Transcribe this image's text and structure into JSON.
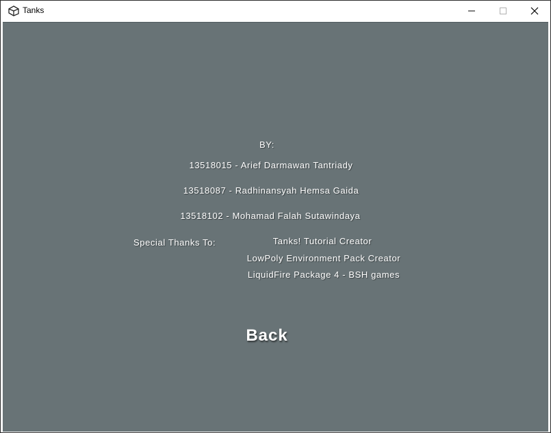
{
  "window": {
    "title": "Tanks"
  },
  "credits": {
    "by_label": "BY:",
    "authors": [
      "13518015 - Arief Darmawan Tantriady",
      "13518087 - Radhinansyah Hemsa Gaida",
      "13518102 - Mohamad Falah Sutawindaya"
    ],
    "thanks_label": "Special Thanks To:",
    "thanks": [
      "Tanks! Tutorial Creator",
      "LowPoly Environment Pack Creator",
      "LiquidFire Package 4 - BSH games"
    ]
  },
  "back_button": {
    "label": "Back"
  },
  "colors": {
    "background": "#687376",
    "text": "#ffffff"
  },
  "icons": {
    "app": "unity-icon",
    "minimize": "minimize-icon",
    "maximize": "maximize-icon",
    "close": "close-icon"
  }
}
